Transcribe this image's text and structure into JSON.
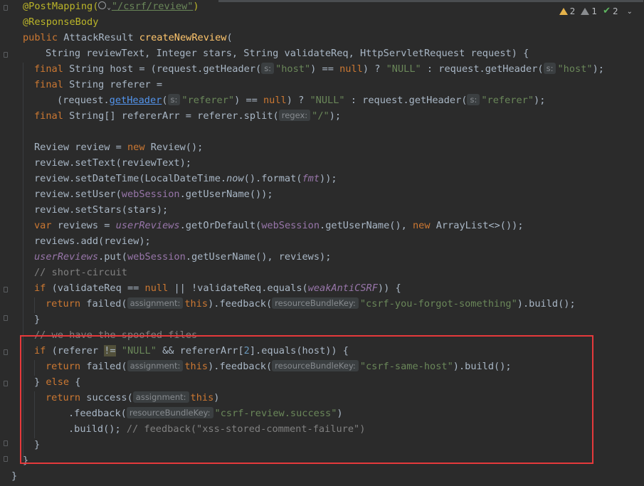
{
  "inspections": {
    "warnings": "2",
    "weak_warnings": "1",
    "ok": "2",
    "chevron": "⌄"
  },
  "code": {
    "l1": {
      "ann": "@PostMapping(",
      "ann_close": ")",
      "url": "\"/csrf/review\""
    },
    "l2": {
      "ann": "@ResponseBody"
    },
    "l3": {
      "kw": "public ",
      "type": "AttackResult ",
      "fn": "createNewReview",
      "rest": "("
    },
    "l4": {
      "text": "String reviewText, Integer stars, String validateReq, HttpServletRequest request) {"
    },
    "l5": {
      "kw": "final ",
      "t1": "String host = (request.getHeader(",
      "hint1": "s:",
      "s1": "\"host\"",
      "t2": ") == ",
      "null1": "null",
      "t3": ") ? ",
      "s2": "\"NULL\"",
      "t4": " : request.getHeader(",
      "hint2": "s:",
      "s3": "\"host\"",
      "t5": ");"
    },
    "l6": {
      "kw": "final ",
      "t1": "String referer ="
    },
    "l7": {
      "t1": "(request.",
      "link": "getHeader",
      "t2": "(",
      "hint": "s:",
      "s1": "\"referer\"",
      "t3": ") == ",
      "null1": "null",
      "t4": ") ? ",
      "s2": "\"NULL\"",
      "t5": " : request.getHeader(",
      "hint2": "s:",
      "s3": "\"referer\"",
      "t6": ");"
    },
    "l8": {
      "kw": "final ",
      "t1": "String[] refererArr = referer.split(",
      "hint": "regex:",
      "s1": "\"/\"",
      "t2": ");"
    },
    "l9": {
      "t1": "Review review = ",
      "kw": "new ",
      "t2": "Review();"
    },
    "l10": {
      "t1": "review.setText(reviewText);"
    },
    "l11": {
      "t1": "review.setDateTime(LocalDateTime.",
      "it": "now",
      "t2": "().format(",
      "fld": "fmt",
      "t3": "));"
    },
    "l12": {
      "t1": "review.setUser(",
      "fld": "webSession",
      "t2": ".getUserName());"
    },
    "l13": {
      "t1": "review.setStars(stars);"
    },
    "l14": {
      "kw": "var ",
      "t1": "reviews = ",
      "fld": "userReviews",
      "t2": ".getOrDefault(",
      "fld2": "webSession",
      "t3": ".getUserName(), ",
      "kw2": "new ",
      "t4": "ArrayList<>());"
    },
    "l15": {
      "t1": "reviews.add(review);"
    },
    "l16": {
      "fld": "userReviews",
      "t1": ".put(",
      "fld2": "webSession",
      "t2": ".getUserName(), reviews);"
    },
    "l17": {
      "cmt": "// short-circuit"
    },
    "l18": {
      "kw": "if ",
      "t1": "(validateReq == ",
      "null1": "null",
      "t2": " || !validateReq.equals(",
      "fld": "weakAntiCSRF",
      "t3": ")) {"
    },
    "l19": {
      "kw": "return ",
      "t1": "failed(",
      "hint1": "assignment:",
      "kw2": "this",
      "t2": ").feedback(",
      "hint2": "resourceBundleKey:",
      "s1": "\"csrf-you-forgot-something\"",
      "t3": ").build();"
    },
    "l20": {
      "t1": "}"
    },
    "l21": {
      "cmt": "// we have the spoofed files"
    },
    "l22": {
      "kw": "if ",
      "t1": "(referer ",
      "op": "!=",
      "t2": " ",
      "s1": "\"NULL\"",
      "t3": " && refererArr[",
      "num": "2",
      "t4": "].equals(host)) {"
    },
    "l23": {
      "kw": "return ",
      "t1": "failed(",
      "hint1": "assignment:",
      "kw2": "this",
      "t2": ").feedback(",
      "hint2": "resourceBundleKey:",
      "s1": "\"csrf-same-host\"",
      "t3": ").build();"
    },
    "l24": {
      "t1": "} ",
      "kw": "else ",
      "t2": "{"
    },
    "l25": {
      "kw": "return ",
      "t1": "success(",
      "hint1": "assignment:",
      "kw2": "this",
      "t2": ")"
    },
    "l26": {
      "t1": ".feedback(",
      "hint1": "resourceBundleKey:",
      "s1": "\"csrf-review.success\"",
      "t2": ")"
    },
    "l27": {
      "t1": ".build(); ",
      "cmt": "// feedback(\"xss-stored-comment-failure\")"
    },
    "l28": {
      "t1": "}"
    },
    "l29": {
      "t1": "}"
    },
    "l30": {
      "t1": "}"
    }
  },
  "colors": {
    "highlight_box": "#e5393b",
    "background": "#2b2b2b",
    "keyword": "#cc7832",
    "string": "#6a8759",
    "annotation": "#bbb529",
    "method": "#ffc66d",
    "field": "#9876aa",
    "comment": "#808080"
  }
}
